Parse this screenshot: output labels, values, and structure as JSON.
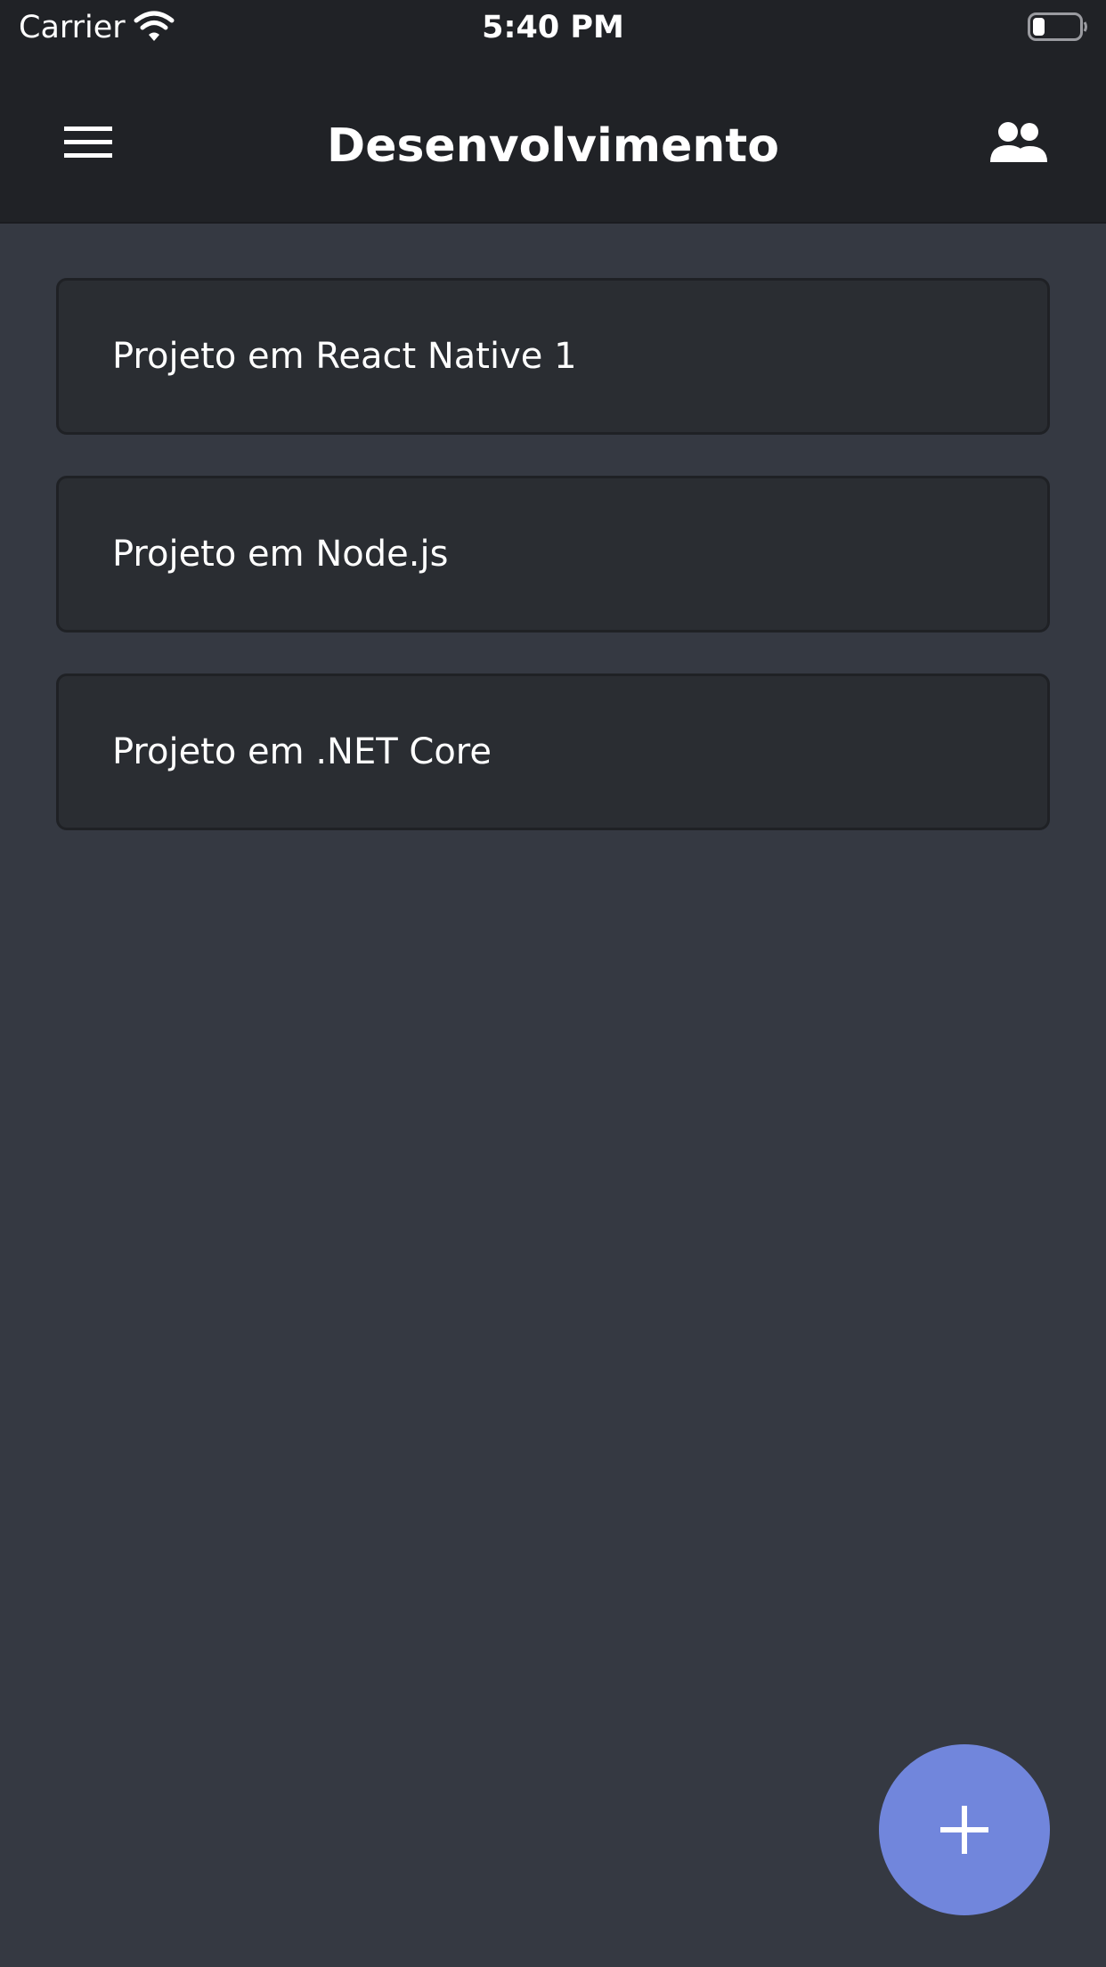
{
  "status_bar": {
    "carrier": "Carrier",
    "time": "5:40 PM",
    "battery_level": 0.25
  },
  "nav": {
    "title": "Desenvolvimento",
    "menu_icon": "hamburger-menu-icon",
    "right_icon": "people-icon"
  },
  "projects": [
    {
      "name": "Projeto em React Native 1"
    },
    {
      "name": "Projeto em Node.js"
    },
    {
      "name": "Projeto em .NET Core"
    }
  ],
  "fab": {
    "icon": "plus-icon",
    "color": "#7186dc"
  },
  "colors": {
    "background": "#353942",
    "header": "#202226",
    "card": "#2a2d32",
    "text": "#ffffff"
  }
}
